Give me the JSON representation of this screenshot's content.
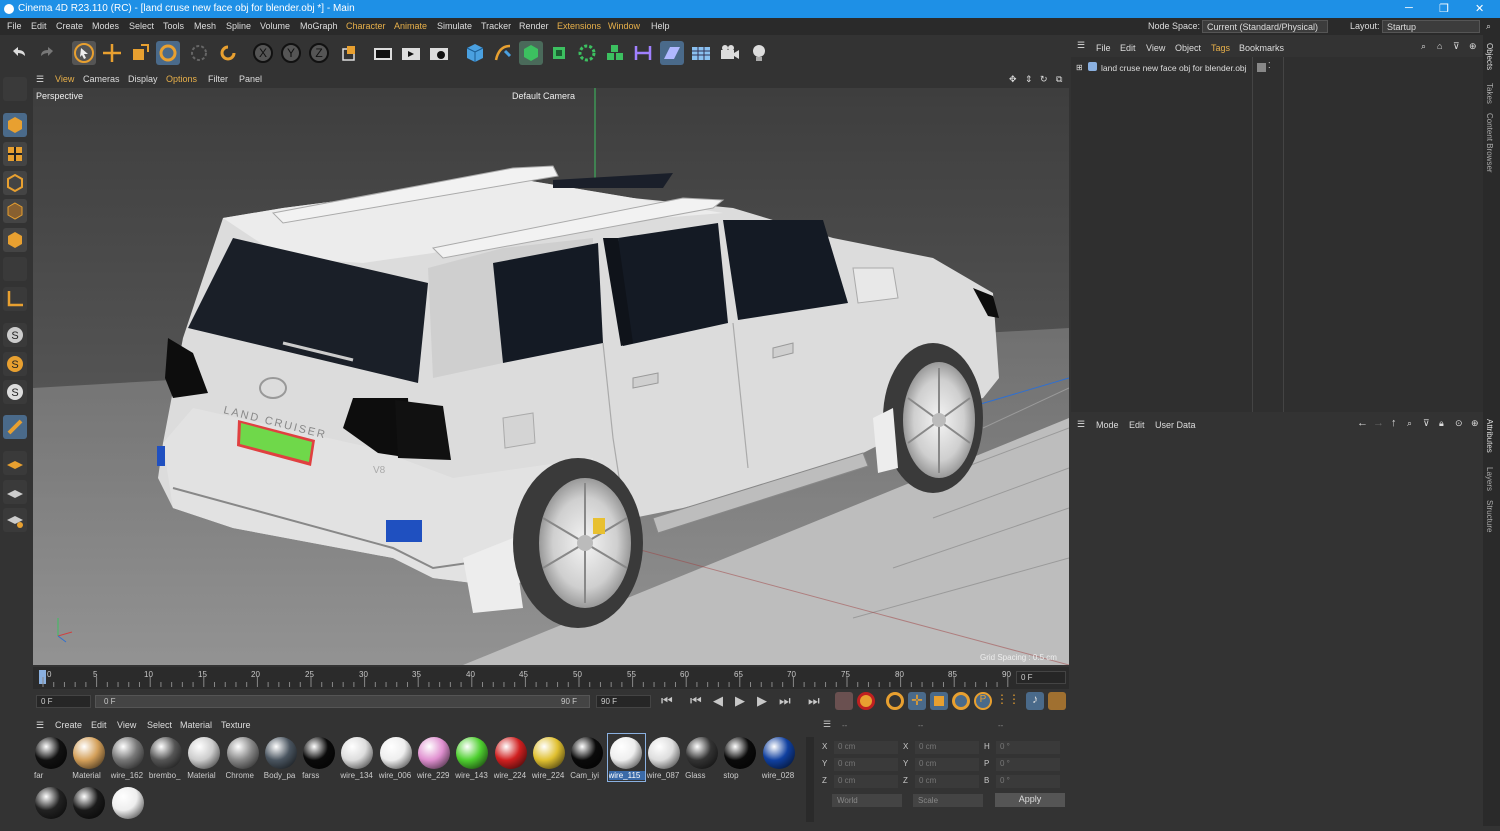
{
  "window": {
    "title": "Cinema 4D R23.110 (RC) - [land cruse new face obj for blender.obj *] - Main"
  },
  "menu": [
    "File",
    "Edit",
    "Create",
    "Modes",
    "Select",
    "Tools",
    "Mesh",
    "Spline",
    "Volume",
    "MoGraph",
    "Character",
    "Animate",
    "Simulate",
    "Tracker",
    "Render",
    "Extensions",
    "Window",
    "Help"
  ],
  "node_space": {
    "label": "Node Space:",
    "value": "Current (Standard/Physical)"
  },
  "layout": {
    "label": "Layout:",
    "value": "Startup"
  },
  "viewport_menu": [
    "View",
    "Cameras",
    "Display",
    "Options",
    "Filter",
    "Panel"
  ],
  "viewport": {
    "name": "Perspective",
    "camera": "Default Camera",
    "grid": "Grid Spacing : 0.5 cm"
  },
  "car": {
    "badge": "LAND CRUISER",
    "model": "V8"
  },
  "timeline": {
    "ticks": [
      "0",
      "5",
      "10",
      "15",
      "20",
      "25",
      "30",
      "35",
      "40",
      "45",
      "50",
      "55",
      "60",
      "65",
      "70",
      "75",
      "80",
      "85",
      "90"
    ],
    "current_frame": "0 F"
  },
  "transport": {
    "start": "0 F",
    "range_start": "0 F",
    "range_end": "90 F",
    "end": "90 F"
  },
  "material_menu": [
    "Create",
    "Edit",
    "View",
    "Select",
    "Material",
    "Texture"
  ],
  "materials": [
    {
      "name": "far",
      "color": "#111"
    },
    {
      "name": "Material",
      "color": "#d4a05a"
    },
    {
      "name": "wire_162",
      "color": "#777"
    },
    {
      "name": "brembo_",
      "color": "#555"
    },
    {
      "name": "Material",
      "color": "#ccc"
    },
    {
      "name": "Chrome",
      "color": "#888"
    },
    {
      "name": "Body_pa",
      "color": "#4a5560"
    },
    {
      "name": "farss",
      "color": "#0a0a0a"
    },
    {
      "name": "wire_134",
      "color": "#ddd"
    },
    {
      "name": "wire_006",
      "color": "#eee"
    },
    {
      "name": "wire_229",
      "color": "#e090d0"
    },
    {
      "name": "wire_143",
      "color": "#4fd030"
    },
    {
      "name": "wire_224",
      "color": "#d02020"
    },
    {
      "name": "wire_224",
      "color": "#e0c030"
    },
    {
      "name": "Cam_iyi",
      "color": "#0a0a0a"
    },
    {
      "name": "wire_115",
      "color": "#eee"
    },
    {
      "name": "wire_087",
      "color": "#ddd"
    },
    {
      "name": "Glass",
      "color": "#333"
    },
    {
      "name": "stop",
      "color": "#0a0a0a"
    },
    {
      "name": "wire_028",
      "color": "#1040a0"
    },
    {
      "name": "",
      "color": "#222"
    },
    {
      "name": "",
      "color": "#1a1a1a"
    },
    {
      "name": "",
      "color": "#eee"
    }
  ],
  "coords": {
    "rows": [
      [
        "X",
        "0 cm",
        "X",
        "0 cm",
        "H",
        "0 °"
      ],
      [
        "Y",
        "0 cm",
        "Y",
        "0 cm",
        "P",
        "0 °"
      ],
      [
        "Z",
        "0 cm",
        "Z",
        "0 cm",
        "B",
        "0 °"
      ]
    ],
    "world": "World",
    "scale": "Scale",
    "apply": "Apply",
    "dashes": [
      "--",
      "--",
      "--"
    ]
  },
  "objects_menu": [
    "File",
    "Edit",
    "View",
    "Object",
    "Tags",
    "Bookmarks"
  ],
  "object_item": "land cruse new face obj for blender.obj",
  "attributes_menu": [
    "Mode",
    "Edit",
    "User Data"
  ],
  "side_tabs": [
    "Objects",
    "Takes",
    "Content Browser",
    "Attributes",
    "Layers",
    "Structure"
  ]
}
